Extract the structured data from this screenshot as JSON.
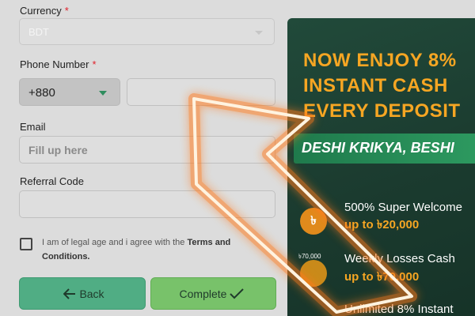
{
  "form": {
    "currency": {
      "label": "Currency",
      "required_mark": "*",
      "value": "BDT"
    },
    "phone": {
      "label": "Phone Number",
      "required_mark": "*",
      "country_code": "+880",
      "value": ""
    },
    "email": {
      "label": "Email",
      "placeholder": "Fill up here",
      "value": ""
    },
    "referral": {
      "label": "Referral Code",
      "value": ""
    },
    "terms": {
      "text_prefix": "I am of legal age and i agree with the",
      "link_text": "Terms and Conditions.",
      "checked": false
    },
    "buttons": {
      "back": "Back",
      "complete": "Complete"
    }
  },
  "promo": {
    "headline_lines": [
      "NOW ENJOY 8%",
      "INSTANT CASH",
      "EVERY DEPOSIT"
    ],
    "ribbon": "DESHI KRIKYA, BESHI",
    "bonuses": [
      {
        "icon_text": "৳",
        "title": "500% Super Welcome",
        "amount": "up to ৳20,000"
      },
      {
        "tag": "৳70,000",
        "title": "Weekly Losses Cash",
        "amount": "up to ৳70,000"
      },
      {
        "title": "Unlimited 8% Instant"
      }
    ]
  },
  "colors": {
    "required": "#e0202a",
    "back_button": "#50ad84",
    "complete_button": "#78c26a",
    "promo_bg": "#1b3b2f",
    "promo_accent": "#f6a623",
    "arrow_glow": "#ff7a1a"
  },
  "overlay": {
    "icon": "glowing-arrow-pointer-icon"
  }
}
